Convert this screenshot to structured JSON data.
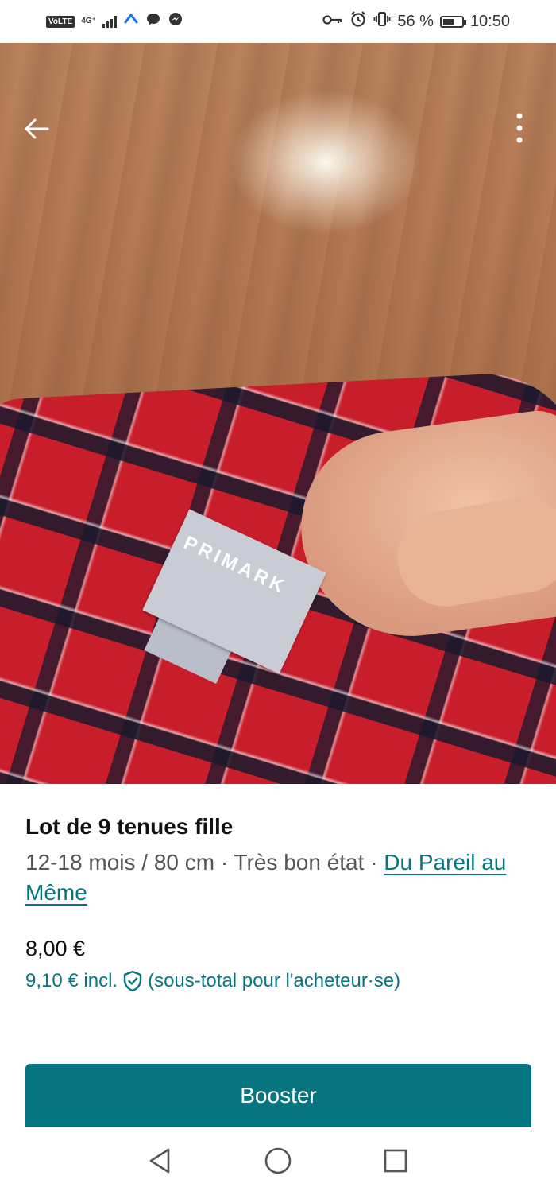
{
  "status_bar": {
    "volte": "VoLTE",
    "network": "4G⁺",
    "battery_percent": "56 %",
    "time": "10:50",
    "icons": [
      "signal-bars-icon",
      "messaging-app-icon",
      "chat-bubble-icon",
      "messenger-icon",
      "key-icon",
      "alarm-icon",
      "vibrate-icon",
      "battery-icon"
    ]
  },
  "photo": {
    "label_text": "PRIMARK",
    "image_count": 4,
    "active_index": 1
  },
  "listing": {
    "title": "Lot de 9 tenues fille",
    "details": "12-18 mois / 80 cm · Très bon état · ",
    "brand": "Du Pareil au Même",
    "price": "8,00 €",
    "price_incl": "9,10 € incl.",
    "price_incl_note": "(sous-total pour l'acheteur·se)"
  },
  "actions": {
    "booster_label": "Booster"
  },
  "colors": {
    "accent": "#077580",
    "text": "#111111",
    "muted": "#555555"
  }
}
